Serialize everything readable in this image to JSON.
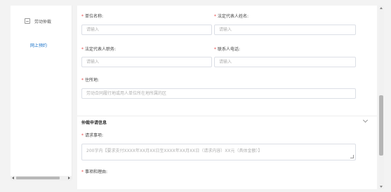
{
  "sidebar": {
    "group_label": "劳动仲裁",
    "item_label": "网上预约"
  },
  "form": {
    "unit_name": {
      "label": "单位名称:",
      "placeholder": "请输入"
    },
    "legal_rep_name": {
      "label": "法定代表人姓名:",
      "placeholder": "请输入"
    },
    "legal_rep_title": {
      "label": "法定代表人职务:",
      "placeholder": "请输入"
    },
    "contact_phone": {
      "label": "联系人电话:",
      "placeholder": "请输入"
    },
    "address": {
      "label": "住所地:",
      "placeholder": "劳动合同履行地或用人单位所在地所属的区"
    },
    "section_title": "仲裁申请信息",
    "request_items": {
      "label": "请求事项:",
      "placeholder": "200字内【要求支付XXXX年XX月XX日至XXXX年XX月XX日（请求内容）XX元（具体金额）】"
    },
    "facts_reasons": {
      "label": "事项和理由:"
    }
  },
  "required_mark": "*"
}
